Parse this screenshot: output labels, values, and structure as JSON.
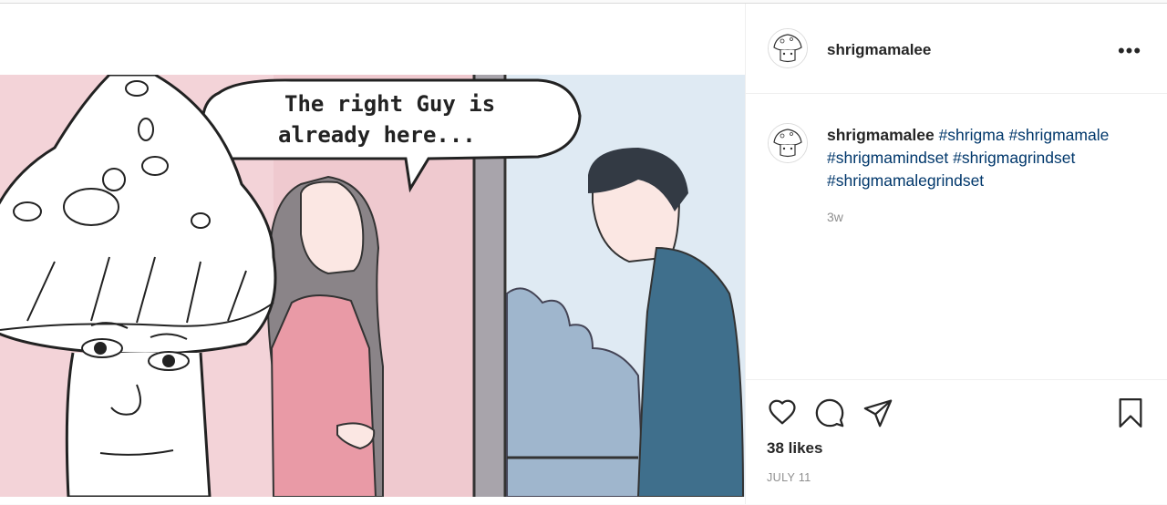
{
  "post": {
    "username": "shrigmamalee",
    "more_options": "•••",
    "caption": {
      "username": "shrigmamalee",
      "hashtags": [
        "#shrigma",
        "#shrigmamale",
        "#shrigmamindset",
        "#shrigmagrindset",
        "#shrigmamalegrindset"
      ]
    },
    "time_ago": "3w",
    "likes": "38 likes",
    "date": "JULY 11",
    "image": {
      "speech_bubble_line1": "The right Guy is",
      "speech_bubble_line2": "already here..."
    }
  },
  "icons": {
    "avatar": "shrigma-mushroom-avatar",
    "more": "more-options-icon",
    "like": "heart-icon",
    "comment": "comment-bubble-icon",
    "share": "paper-plane-icon",
    "save": "bookmark-icon"
  },
  "colors": {
    "hashtag": "#00376b",
    "text": "#262626",
    "muted": "#8e8e8e",
    "border": "#efefef"
  }
}
